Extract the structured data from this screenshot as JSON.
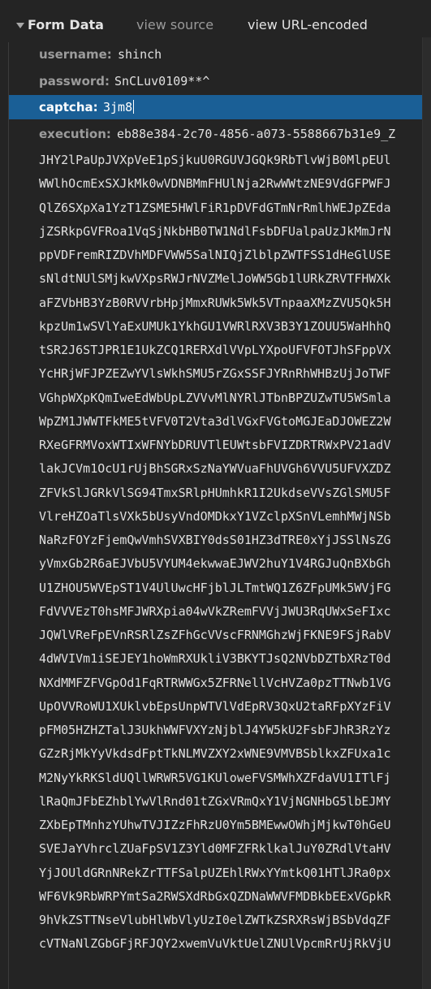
{
  "section": {
    "title": "Form Data",
    "view_source": "view source",
    "view_url_encoded": "view URL-encoded"
  },
  "fields": [
    {
      "key": "username:",
      "value": "shinch"
    },
    {
      "key": "password:",
      "value": "SnCLuv0109**^"
    },
    {
      "key": "captcha:",
      "value": "3jm8"
    },
    {
      "key": "execution:",
      "value": "eb88e384-2c70-4856-a073-5588667b31e9_Z"
    }
  ],
  "execution_continuation": [
    "JHY2lPaUpJVXpVeE1pSjkuU0RGUVJGQk9RbTlvWjB0MlpEUl",
    "WWlhOcmExSXJkMk0wVDNBMmFHUlNja2RwWWtzNE9VdGFPWFJ",
    "QlZ6SXpXa1YzT1ZSME5HWlFiR1pDVFdGTmNrRmlhWEJpZEda",
    "jZSRkpGVFRoa1VqSjNkbHB0TW1NdlFsbDFUalpaUzJkMmJrN",
    "ppVDFremRIZDVhMDFVWW5SalNIQjZlblpZWTFSS1dHeGlUSE",
    "sNldtNUlSMjkwVXpsRWJrNVZMelJoWW5Gb1lURkZRVTFHWXk",
    "aFZVbHB3YzB0RVVrbHpjMmxRUWk5Wk5VTnpaaXMzZVU5Qk5H",
    "kpzUm1wSVlYaExUMUk1YkhGU1VWRlRXV3B3Y1ZOUU5WaHhhQ",
    "tSR2J6STJPR1E1UkZCQ1RERXdlVVpLYXpoUFVFOTJhSFppVX",
    "YcHRjWFJPZEZwYVlsWkhSMU5rZGxSSFJYRnRhWHBzUjJoTWF",
    "VGhpWXpKQmIweEdWbUpLZVVvMlNYRlJTbnBPZUZwTU5WSmla",
    "WpZM1JWWTFkME5tVFV0T2Vta3dlVGxFVGtoMGJEaDJOWEZ2W",
    "RXeGFRMVoxWTIxWFNYbDRUVTlEUWtsbFVIZDRTRWxPV21adV",
    "lakJCVm1OcU1rUjBhSGRxSzNaYWVuaFhUVGh6VVU5UFVXZDZ",
    "ZFVkSlJGRkVlSG94TmxSRlpHUmhkR1I2UkdseVVsZGlSMU5F",
    "VlreHZOaTlsVXk5bUsyVndOMDkxY1VZclpXSnVLemhMWjNSb",
    "NaRzFOYzFjemQwVmhSVXBIY0dsS01HZ3dTRE0xYjJSSlNsZG",
    "yVmxGb2R6aEJVbU5VYUM4ekwwaEJWV2huY1V4RGJuQnBXbGh",
    "U1ZHOU5WVEpST1V4UlUwcHFjblJLTmtWQ1Z6ZFpUMk5WVjFG",
    "FdVVVEzT0hsMFJWRXpia04wVkZRemFVVjJWU3RqUWxSeFIxc",
    "JQWlVReFpEVnRSRlZsZFhGcVVscFRNMGhzWjFKNE9FSjRabV",
    "4dWVIVm1iSEJEY1hoWmRXUkliV3BKYTJsQ2NVbDZTbXRzT0d",
    "NXdMMFZFVGpOd1FqRTRWWGx5ZFRNellVcHVZa0pzTTNwb1VG",
    "UpOVVRoWU1XUklvbEpsUnpWTVlVdEpRV3QxU2taRFpXYzFiV",
    "pFM05HZHZTalJ3UkhWWFVXYzNjblJ4YW5kU2FsbFJhR3RzYz",
    "GZzRjMkYyVkdsdFptTkNLMVZXY2xWNE9VMVBSblkxZFUxa1c",
    "M2NyYkRKSldUQllWRWR5VG1KUloweFVSMWhXZFdaVU1ITlFj",
    "lRaQmJFbEZhblYwVlRnd01tZGxVRmQxY1VjNGNHbG5lbEJMY",
    "ZXbEpTMnhzYUhwTVJIZzFhRzU0Ym5BMEwwOWhjMjkwT0hGeU",
    "SVEJaYVhrclZUaFpSV1Z3Yld0MFZFRklkalJuY0ZRdlVtaHV",
    "YjJOUldGRnNRekZrTTFSalpUZEhlRWxYYmtkQ01HTlJRa0px",
    "WF6Vk9RbWRPYmtSa2RWSXdRbGxQZDNaWWVFMDBkbEExVGpkR",
    "9hVkZSTTNseVlubHlWbVlyUzI0elZWTkZSRXRsWjBSbVdqZF",
    "cVTNaNlZGbGFjRFJQY2xwemVuVktUelZNUlVpcmRrUjRkVjU"
  ]
}
